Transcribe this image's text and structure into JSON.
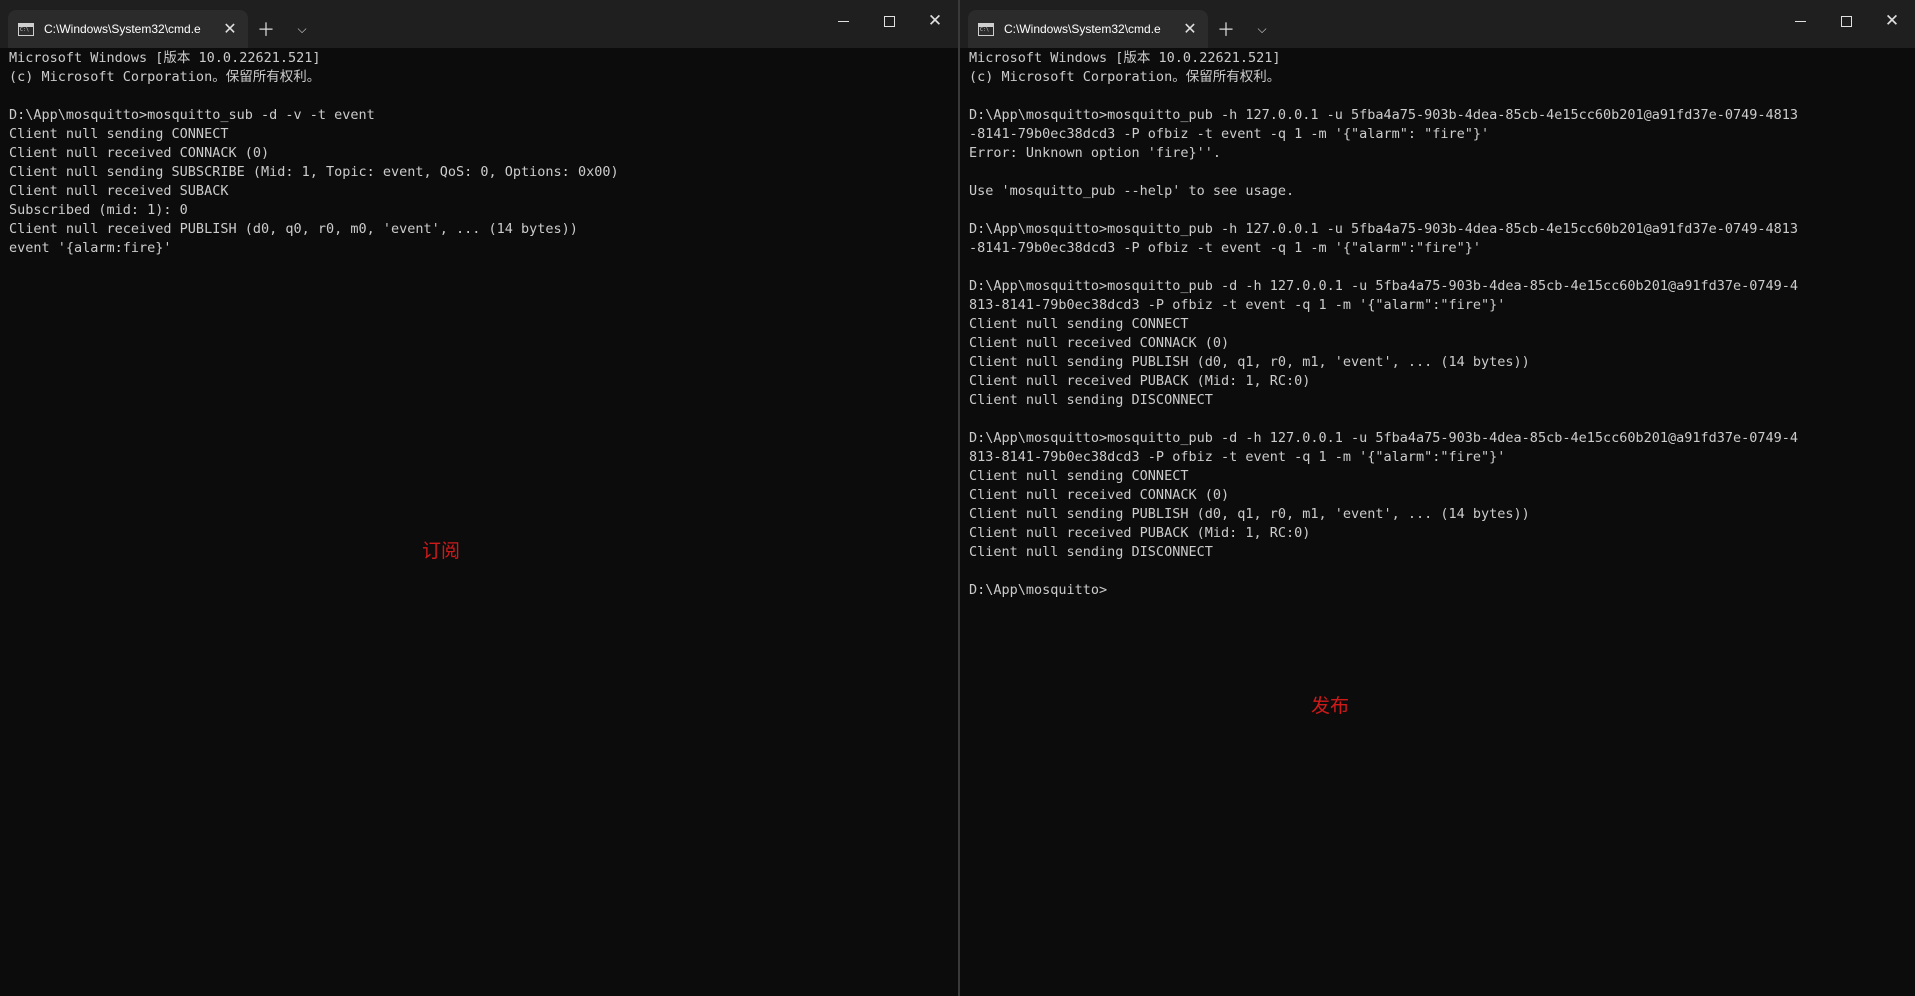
{
  "left_window": {
    "tab_title": "C:\\Windows\\System32\\cmd.e",
    "annotation": "订阅",
    "lines": [
      "Microsoft Windows [版本 10.0.22621.521]",
      "(c) Microsoft Corporation。保留所有权利。",
      "",
      "D:\\App\\mosquitto>mosquitto_sub -d -v -t event",
      "Client null sending CONNECT",
      "Client null received CONNACK (0)",
      "Client null sending SUBSCRIBE (Mid: 1, Topic: event, QoS: 0, Options: 0x00)",
      "Client null received SUBACK",
      "Subscribed (mid: 1): 0",
      "Client null received PUBLISH (d0, q0, r0, m0, 'event', ... (14 bytes))",
      "event '{alarm:fire}'"
    ]
  },
  "right_window": {
    "tab_title": "C:\\Windows\\System32\\cmd.e",
    "annotation": "发布",
    "lines": [
      "Microsoft Windows [版本 10.0.22621.521]",
      "(c) Microsoft Corporation。保留所有权利。",
      "",
      "D:\\App\\mosquitto>mosquitto_pub -h 127.0.0.1 -u 5fba4a75-903b-4dea-85cb-4e15cc60b201@a91fd37e-0749-4813",
      "-8141-79b0ec38dcd3 -P ofbiz -t event -q 1 -m '{\"alarm\": \"fire\"}'",
      "Error: Unknown option 'fire}''.",
      "",
      "Use 'mosquitto_pub --help' to see usage.",
      "",
      "D:\\App\\mosquitto>mosquitto_pub -h 127.0.0.1 -u 5fba4a75-903b-4dea-85cb-4e15cc60b201@a91fd37e-0749-4813",
      "-8141-79b0ec38dcd3 -P ofbiz -t event -q 1 -m '{\"alarm\":\"fire\"}'",
      "",
      "D:\\App\\mosquitto>mosquitto_pub -d -h 127.0.0.1 -u 5fba4a75-903b-4dea-85cb-4e15cc60b201@a91fd37e-0749-4",
      "813-8141-79b0ec38dcd3 -P ofbiz -t event -q 1 -m '{\"alarm\":\"fire\"}'",
      "Client null sending CONNECT",
      "Client null received CONNACK (0)",
      "Client null sending PUBLISH (d0, q1, r0, m1, 'event', ... (14 bytes))",
      "Client null received PUBACK (Mid: 1, RC:0)",
      "Client null sending DISCONNECT",
      "",
      "D:\\App\\mosquitto>mosquitto_pub -d -h 127.0.0.1 -u 5fba4a75-903b-4dea-85cb-4e15cc60b201@a91fd37e-0749-4",
      "813-8141-79b0ec38dcd3 -P ofbiz -t event -q 1 -m '{\"alarm\":\"fire\"}'",
      "Client null sending CONNECT",
      "Client null received CONNACK (0)",
      "Client null sending PUBLISH (d0, q1, r0, m1, 'event', ... (14 bytes))",
      "Client null received PUBACK (Mid: 1, RC:0)",
      "Client null sending DISCONNECT",
      "",
      "D:\\App\\mosquitto>"
    ]
  },
  "icons": {
    "tab": "cmd-terminal-icon",
    "close_tab": "close-icon",
    "new_tab": "plus-icon",
    "dropdown": "chevron-down-icon",
    "minimize": "minimize-icon",
    "maximize": "maximize-icon",
    "close_window": "close-icon"
  },
  "colors": {
    "background": "#0c0c0c",
    "titlebar": "#1f1f1f",
    "tab": "#2b2b2b",
    "text": "#cccccc",
    "annotation": "#d01a1a"
  }
}
